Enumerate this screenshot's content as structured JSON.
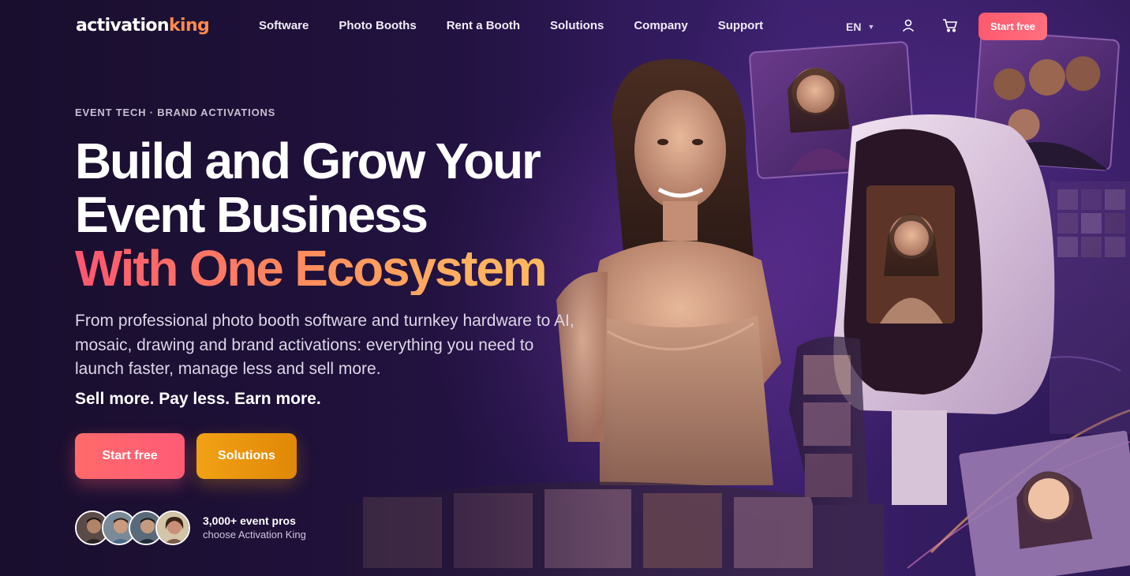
{
  "brand": {
    "logo_part1": "activation",
    "logo_part2": "king"
  },
  "nav": {
    "links": [
      "Software",
      "Photo Booths",
      "Rent a Booth",
      "Solutions",
      "Company",
      "Support"
    ],
    "language": "EN",
    "cta_label": "Start free",
    "user_icon": "user-icon",
    "cart_icon": "cart-icon"
  },
  "hero": {
    "eyebrow": "EVENT TECH · BRAND ACTIVATIONS",
    "headline_line1": "Build and Grow Your",
    "headline_line2": "Event Business",
    "headline_line3": "With One Ecosystem",
    "description": "From professional photo booth software and turnkey hardware to AI, mosaic, drawing and brand activations: everything you need to launch faster, manage less and sell more.",
    "tagline": "Sell more. Pay less. Earn more.",
    "primary_cta": "Start free",
    "secondary_cta": "Solutions"
  },
  "social_proof": {
    "title": "3,000+ event pros",
    "subtitle": "choose Activation King"
  },
  "colors": {
    "accent_pink": "#ff5a6e",
    "accent_orange": "#f2a114",
    "background": "#1e1136"
  }
}
